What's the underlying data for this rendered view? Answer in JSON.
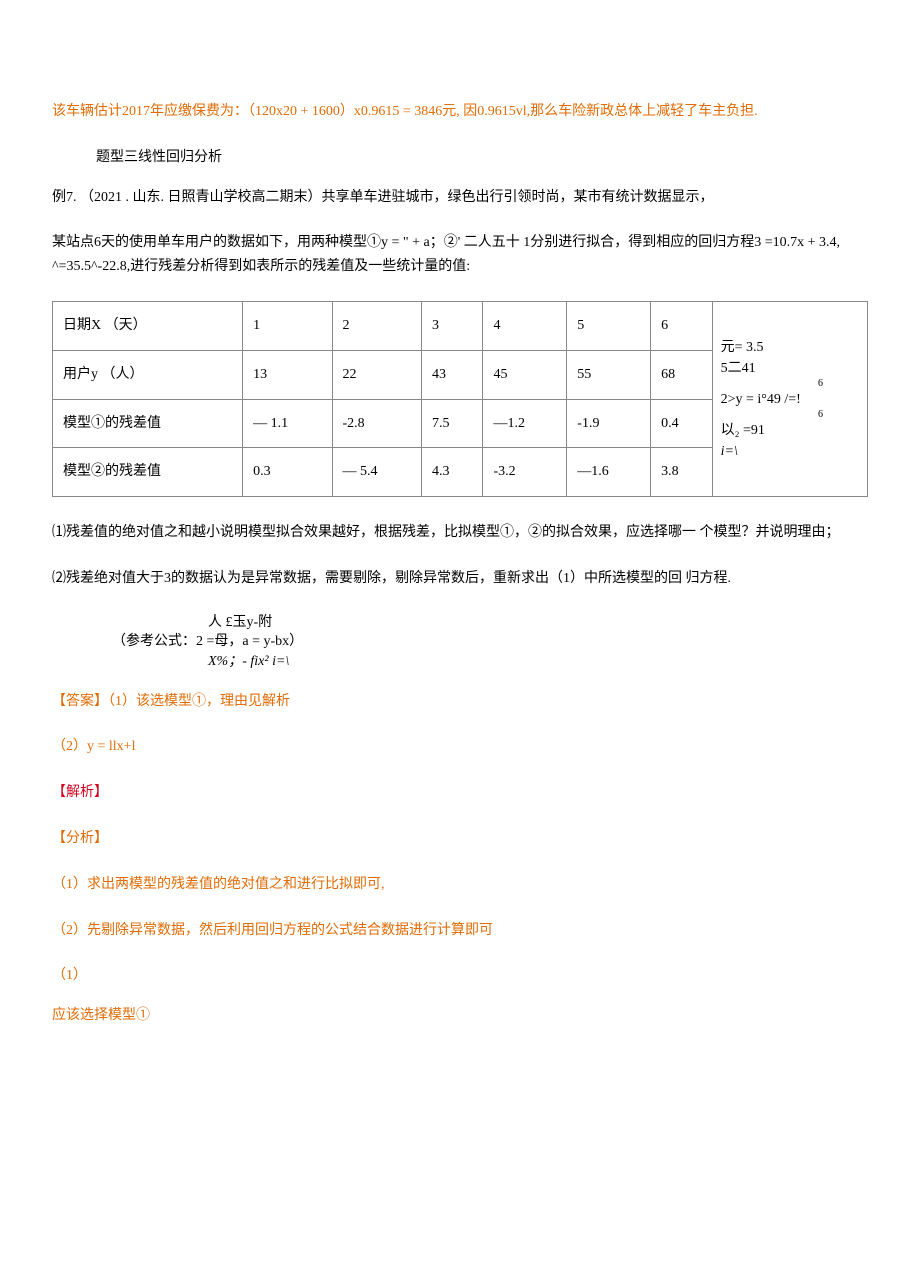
{
  "lines": {
    "l1": "该车辆估计2017年应缴保费为：（120x20 + 1600）x0.9615 = 3846元,   因0.9615vl,那么车险新政总体上减轻了车主负担.",
    "l2": "题型三线性回归分析",
    "l3": "例7. （2021 . 山东. 日照青山学校高二期末）共享单车进驻城市，绿色出行引领时尚，某市有统计数据显示，",
    "l4": "某站点6天的使用单车用户的数据如下，用两种模型①y = \" + a；②' 二人五十 1分别进行拟合，得到相应的回归方程3 =10.7x + 3.4, ^=35.5^-22.8,进行残差分析得到如表所示的残差值及一些统计量的值:",
    "q1": "⑴残差值的绝对值之和越小说明模型拟合效果越好，根据残差，比拟模型①，②的拟合效果，应选择哪一 个模型？并说明理由；",
    "q2": "⑵残差绝对值大于3的数据认为是异常数据，需要剔除，剔除异常数后，重新求出（1）中所选模型的回 归方程.",
    "formula_top": "人 £玉y-附",
    "formula_mid": "（参考公式：2 =母，a = y-bx）",
    "formula_bot": "X%；- fix² i=\\",
    "ans_hdr": "【答案】（1）该选模型①，理由见解析",
    "ans2": "（2）y = llx+l",
    "jiexi": "【解析】",
    "fenxi": "【分析】",
    "fx1": "（1）求出两模型的残差值的绝对值之和进行比拟即可,",
    "fx2": "（2）先剔除异常数据，然后利用回归方程的公式结合数据进行计算即可",
    "part1_num": "（1）",
    "part1_text": "应该选择模型①"
  },
  "table": {
    "rows": [
      [
        "日期X  （天）",
        "1",
        "2",
        "3",
        "4",
        "5",
        "6"
      ],
      [
        "用户y （人）",
        "13",
        "22",
        "43",
        "45",
        "55",
        "68"
      ],
      [
        "模型①的残差值",
        "— 1.1",
        "-2.8",
        "7.5",
        "—1.2",
        "-1.9",
        "0.4"
      ],
      [
        "模型②的残差值",
        "0.3",
        "— 5.4",
        "4.3",
        "-3.2",
        "—1.6",
        "3.8"
      ]
    ],
    "side": {
      "line1": "元=  3.5",
      "line2": "5二41",
      "sup1": "6",
      "line3": "2>y = i°49 /=!",
      "sup2": "6",
      "line4": "以₂ =91",
      "line5": " i=\\"
    }
  }
}
